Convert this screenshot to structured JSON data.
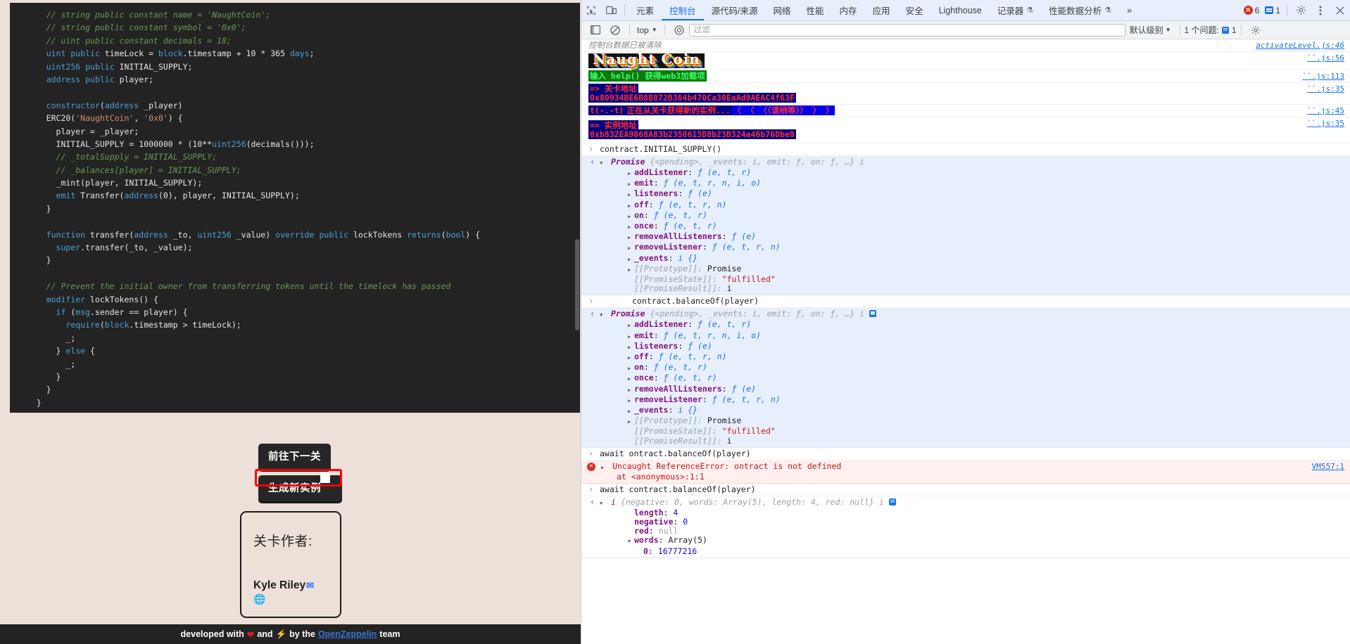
{
  "page": {
    "code_lines": [
      {
        "t": "com",
        "s": "    // string public constant name = 'NaughtCoin';"
      },
      {
        "t": "com",
        "s": "    // string public constant symbol = '0x0';"
      },
      {
        "t": "com",
        "s": "    // uint public constant decimals = 18;"
      },
      {
        "t": "mix",
        "s": "    uint public timeLock = block.timestamp + 10 * 365 days;"
      },
      {
        "t": "mix",
        "s": "    uint256 public INITIAL_SUPPLY;"
      },
      {
        "t": "mix",
        "s": "    address public player;"
      },
      {
        "t": "blank",
        "s": ""
      },
      {
        "t": "mix",
        "s": "    constructor(address _player)"
      },
      {
        "t": "mix",
        "s": "    ERC20('NaughtCoin', '0x0') {"
      },
      {
        "t": "mix",
        "s": "      player = _player;"
      },
      {
        "t": "mix",
        "s": "      INITIAL_SUPPLY = 1000000 * (10**uint256(decimals()));"
      },
      {
        "t": "com",
        "s": "      // _totalSupply = INITIAL_SUPPLY;"
      },
      {
        "t": "com",
        "s": "      // _balances[player] = INITIAL_SUPPLY;"
      },
      {
        "t": "mix",
        "s": "      _mint(player, INITIAL_SUPPLY);"
      },
      {
        "t": "mix",
        "s": "      emit Transfer(address(0), player, INITIAL_SUPPLY);"
      },
      {
        "t": "mix",
        "s": "    }"
      },
      {
        "t": "blank",
        "s": ""
      },
      {
        "t": "mix",
        "s": "    function transfer(address _to, uint256 _value) override public lockTokens returns(bool) {"
      },
      {
        "t": "mix",
        "s": "      super.transfer(_to, _value);"
      },
      {
        "t": "mix",
        "s": "    }"
      },
      {
        "t": "blank",
        "s": ""
      },
      {
        "t": "com",
        "s": "    // Prevent the initial owner from transferring tokens until the timelock has passed"
      },
      {
        "t": "mix",
        "s": "    modifier lockTokens() {"
      },
      {
        "t": "mix",
        "s": "      if (msg.sender == player) {"
      },
      {
        "t": "mix",
        "s": "        require(block.timestamp > timeLock);"
      },
      {
        "t": "mix",
        "s": "        _;"
      },
      {
        "t": "mix",
        "s": "      } else {"
      },
      {
        "t": "mix",
        "s": "        _;"
      },
      {
        "t": "mix",
        "s": "      }"
      },
      {
        "t": "mix",
        "s": "    }"
      },
      {
        "t": "mix",
        "s": "  }"
      }
    ],
    "buttons": {
      "next_level": "前往下一关",
      "new_instance": "生成新实例"
    },
    "author_card": {
      "label": "关卡作者:",
      "name": "Kyle Riley",
      "mail_icon": "envelope-icon",
      "site_icon": "globe-icon"
    },
    "footer": {
      "pre": "developed with",
      "heart": "❤",
      "mid": "and",
      "bolt": "⚡",
      "by": "by the",
      "link": "OpenZeppelin",
      "post": "team"
    }
  },
  "devtools": {
    "toolbar": {
      "inspect_icon": "inspect-element-icon",
      "device_icon": "device-toolbar-icon",
      "tabs": [
        {
          "label": "元素",
          "active": false,
          "flask": false
        },
        {
          "label": "控制台",
          "active": true,
          "flask": false
        },
        {
          "label": "源代码/来源",
          "active": false,
          "flask": false
        },
        {
          "label": "网络",
          "active": false,
          "flask": false
        },
        {
          "label": "性能",
          "active": false,
          "flask": false
        },
        {
          "label": "内存",
          "active": false,
          "flask": false
        },
        {
          "label": "应用",
          "active": false,
          "flask": false
        },
        {
          "label": "安全",
          "active": false,
          "flask": false
        },
        {
          "label": "Lighthouse",
          "active": false,
          "flask": false
        },
        {
          "label": "记录器",
          "active": false,
          "flask": true
        },
        {
          "label": "性能数据分析",
          "active": false,
          "flask": true
        }
      ],
      "overflow": "»",
      "error_count": "6",
      "info_count": "1",
      "settings_icon": "gear-icon",
      "more_icon": "kebab-menu-icon",
      "close_icon": "close-icon"
    },
    "filterbar": {
      "sidebar_icon": "console-sidebar-icon",
      "clear_icon": "clear-console-icon",
      "context": "top",
      "eye_icon": "live-expression-icon",
      "filter_placeholder": "过滤",
      "filter_value": "",
      "level": "默认级别",
      "issues_label": "1 个问题:",
      "issues_count": "1",
      "settings_icon": "gear-icon"
    },
    "console": {
      "cleared_msg": "控制台数据已被清除",
      "refs": {
        "activate": "activateLevel.js:46",
        "r56": "``.js:56",
        "r113": "``.js:113",
        "r35a": "``.js:35",
        "r45": "``.js:45",
        "r35b": "``.js:35",
        "vm": "VM557:1"
      },
      "banner_text": "Naught Coin",
      "help_msg": "输入 help() 获得web3加载项",
      "level_label": "=> 关卡地址",
      "level_address": "0x80934BE6B8B872B364b470Ca30EaAd8AEAC4f63F",
      "fetching_face": "t(-.-t)",
      "fetching_msg": "正在从关卡获得新的实例...",
      "waiting_msg": "〈 〈 〈〈请稍等〉〉 〉 〉",
      "instance_label": "=> 实例地址",
      "instance_address": "0xb832EA9068A83b2358615D8b23B324a46b76Dbe8",
      "cmd1": "contract.INITIAL_SUPPLY()",
      "cmd2": "contract.balanceOf(player)",
      "cmd3": "await ontract.balanceOf(player)",
      "cmd4": "await contract.balanceOf(player)",
      "promise_head": {
        "name": "Promise",
        "preview": "{<pending>, _events: i, emit: ƒ, on: ƒ, …} i"
      },
      "promise_props": [
        {
          "key": "addListener",
          "val": "ƒ (e, t, r)"
        },
        {
          "key": "emit",
          "val": "ƒ (e, t, r, n, i, o)"
        },
        {
          "key": "listeners",
          "val": "ƒ (e)"
        },
        {
          "key": "off",
          "val": "ƒ (e, t, r, n)"
        },
        {
          "key": "on",
          "val": "ƒ (e, t, r)"
        },
        {
          "key": "once",
          "val": "ƒ (e, t, r)"
        },
        {
          "key": "removeAllListeners",
          "val": "ƒ (e)"
        },
        {
          "key": "removeListener",
          "val": "ƒ (e, t, r, n)"
        },
        {
          "key": "_events",
          "val": "i  {}"
        }
      ],
      "promise_state_key": "[[PromiseState]]:",
      "promise_state_val": "\"fulfilled\"",
      "promise_result_key": "[[PromiseResult]]:",
      "promise_result_val": "i",
      "promise_proto_key": "[[Prototype]]:",
      "promise_proto_val": "Promise",
      "error": {
        "title": "Uncaught ReferenceError: ontract is not defined",
        "stack": "at <anonymous>:1:1"
      },
      "bn_head_name": "i",
      "bn_head_preview": "{negative: 0, words: Array(5), length: 4, red: null} i",
      "bn_props": [
        {
          "key": "length",
          "val": "4",
          "type": "num"
        },
        {
          "key": "negative",
          "val": "0",
          "type": "num"
        },
        {
          "key": "red",
          "val": "null",
          "type": "null"
        },
        {
          "key": "words",
          "val": "Array(5)",
          "type": "plain"
        }
      ],
      "bn_word0_key": "0",
      "bn_word0_val": "16777216"
    }
  }
}
